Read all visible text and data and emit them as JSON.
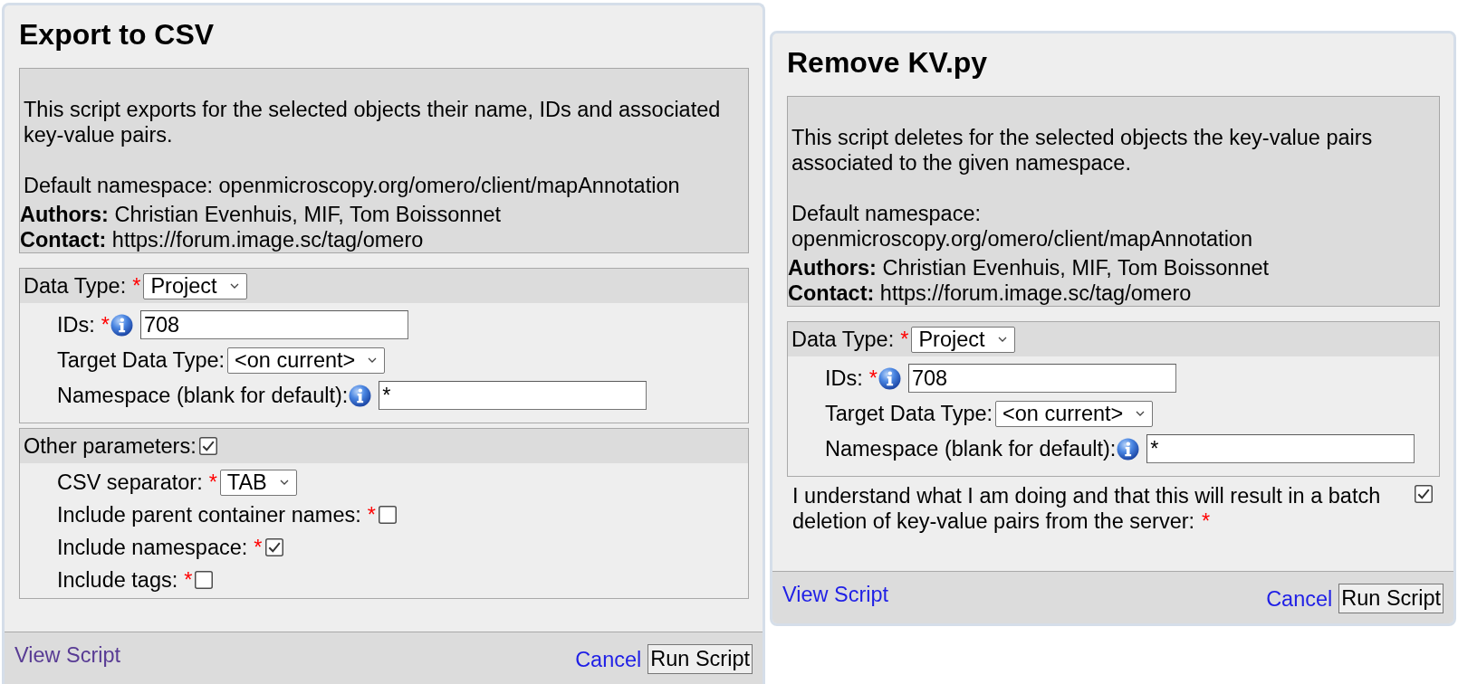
{
  "dialogs": [
    {
      "title": "Export to CSV",
      "description": {
        "paragraphs": [
          "This script exports for the selected objects their name, IDs and associated key-value pairs.",
          "Default namespace: openmicroscopy.org/omero/client/mapAnnotation"
        ],
        "authors": "**Authors:** Christian Evenhuis, MIF, Tom Boissonnet",
        "contact": "**Contact:** https://forum.image.sc/tag/omero"
      },
      "sections": [
        {
          "header": {
            "kind": "select",
            "label": "Data Type:",
            "required_mark": "*",
            "info": false,
            "value": "Project"
          },
          "fields": [
            {
              "kind": "text",
              "label": "IDs:",
              "required_mark": "*",
              "info": true,
              "value": "708"
            },
            {
              "kind": "select",
              "label": "Target Data Type:",
              "info": false,
              "value": "<on current>"
            },
            {
              "kind": "text",
              "label": "Namespace (blank for default):",
              "info": true,
              "value": "*"
            }
          ]
        },
        {
          "header": {
            "kind": "checkbox",
            "label": "Other parameters:",
            "info": false,
            "checked": true
          },
          "fields": [
            {
              "kind": "select",
              "label": "CSV separator:",
              "required_mark": "*",
              "info": false,
              "value": "TAB"
            },
            {
              "kind": "checkbox",
              "label": "Include parent container names:",
              "required_mark": "*",
              "info": false,
              "checked": false
            },
            {
              "kind": "checkbox",
              "label": "Include namespace:",
              "required_mark": "*",
              "info": false,
              "checked": true
            },
            {
              "kind": "checkbox",
              "label": "Include tags:",
              "required_mark": "*",
              "info": false,
              "checked": false
            }
          ]
        }
      ],
      "footer": {
        "view_script": {
          "label": "View Script",
          "visited": true
        },
        "cancel": "Cancel",
        "run": "Run Script"
      }
    },
    {
      "title": "Remove KV.py",
      "description": {
        "paragraphs": [
          "This script deletes for the selected objects the key-value pairs associated to the given namespace.",
          "Default namespace: openmicroscopy.org/omero/client/mapAnnotation"
        ],
        "authors": "**Authors:** Christian Evenhuis, MIF, Tom Boissonnet",
        "contact": "**Contact:** https://forum.image.sc/tag/omero"
      },
      "sections": [
        {
          "header": {
            "kind": "select",
            "label": "Data Type:",
            "required_mark": "*",
            "info": false,
            "value": "Project"
          },
          "fields": [
            {
              "kind": "text",
              "label": "IDs:",
              "required_mark": "*",
              "info": true,
              "value": "708"
            },
            {
              "kind": "select",
              "label": "Target Data Type:",
              "info": false,
              "value": "<on current>"
            },
            {
              "kind": "text",
              "label": "Namespace (blank for default):",
              "info": true,
              "value": "*"
            }
          ]
        }
      ],
      "confirmation": {
        "label": "I understand what I am doing and that this will result in a batch deletion of key-value pairs from the server:",
        "required_mark": "*",
        "checked": true
      },
      "footer": {
        "view_script": {
          "label": "View Script",
          "visited": false
        },
        "cancel": "Cancel",
        "run": "Run Script"
      }
    }
  ]
}
